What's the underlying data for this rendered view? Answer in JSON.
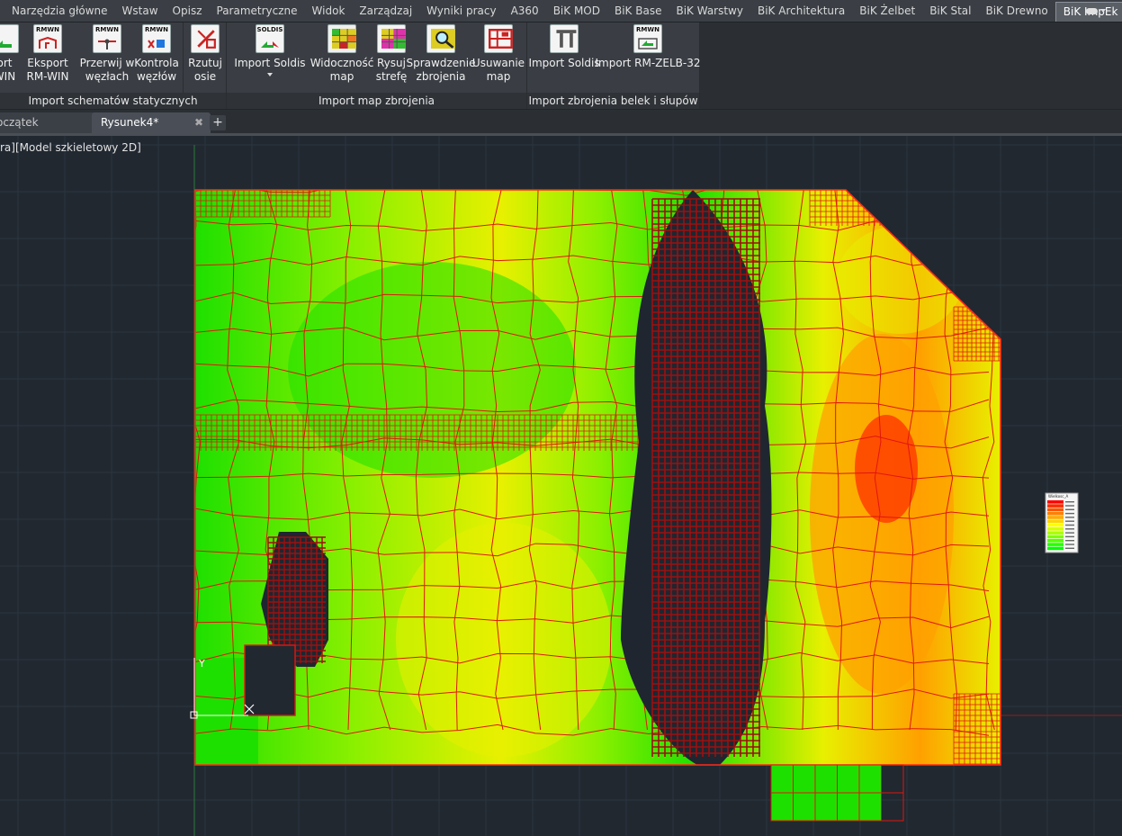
{
  "ribbon": {
    "tabs": [
      {
        "label": "Narzędzia główne",
        "active": false
      },
      {
        "label": "Wstaw",
        "active": false
      },
      {
        "label": "Opisz",
        "active": false
      },
      {
        "label": "Parametryczne",
        "active": false
      },
      {
        "label": "Widok",
        "active": false
      },
      {
        "label": "Zarządzaj",
        "active": false
      },
      {
        "label": "Wyniki pracy",
        "active": false
      },
      {
        "label": "A360",
        "active": false
      },
      {
        "label": "BiK MOD",
        "active": false
      },
      {
        "label": "BiK Base",
        "active": false
      },
      {
        "label": "BiK Warstwy",
        "active": false
      },
      {
        "label": "BiK Architektura",
        "active": false
      },
      {
        "label": "BiK Żelbet",
        "active": false
      },
      {
        "label": "BiK Stal",
        "active": false
      },
      {
        "label": "BiK Drewno",
        "active": false
      },
      {
        "label": "BiK ImpEk",
        "active": true
      }
    ],
    "panels": {
      "static": {
        "title": "Import schematów statycznych",
        "buttons": [
          {
            "line1": "ort",
            "line2": "WIN",
            "icon_text": ""
          },
          {
            "line1": "Eksport",
            "line2": "RM-WIN",
            "icon_text": "RMWN"
          },
          {
            "line1": "Przerwij w",
            "line2": "węzłach",
            "icon_text": "RMWN"
          },
          {
            "line1": "Kontrola",
            "line2": "węzłów",
            "icon_text": "RMWN"
          },
          {
            "line1": "Rzutuj",
            "line2": "osie",
            "icon_text": ""
          }
        ]
      },
      "maps": {
        "title": "Import map zbrojenia",
        "buttons": [
          {
            "line1": "Import Soldis",
            "line2": "",
            "icon_text": "SOLDIS"
          },
          {
            "line1": "Widoczność",
            "line2": "map",
            "icon_text": ""
          },
          {
            "line1": "Rysuj",
            "line2": "strefę",
            "icon_text": ""
          },
          {
            "line1": "Sprawdzenie",
            "line2": "zbrojenia",
            "icon_text": ""
          },
          {
            "line1": "Usuwanie",
            "line2": "map",
            "icon_text": ""
          }
        ]
      },
      "beams": {
        "title": "Import zbrojenia belek i słupów",
        "buttons": [
          {
            "line1": "Import Soldis",
            "line2": "",
            "icon_text": ""
          },
          {
            "line1": "Import RM-ZELB-32",
            "line2": "",
            "icon_text": "RMWN"
          }
        ]
      }
    },
    "colors": {
      "strip": "#3b3f45",
      "panel": "#3a3e44",
      "panel_title": "#2f3338"
    }
  },
  "documents": {
    "tabs": [
      {
        "label": "oczątek",
        "active": false
      },
      {
        "label": "Rysunek4*",
        "active": true
      }
    ],
    "close_glyph": "✖",
    "add_glyph": "+"
  },
  "viewport": {
    "label": "ra][Model szkieletowy 2D]",
    "background": "#212830",
    "ucs": {
      "y_label": "Y"
    },
    "legend": {
      "title": "Wielkosc_A",
      "colors": [
        "#ff0000",
        "#ff2a00",
        "#ff5500",
        "#ff7f00",
        "#ffaa00",
        "#ffd400",
        "#ffff00",
        "#d4ff00",
        "#aaff00",
        "#7fff00",
        "#55ff00",
        "#2aff00",
        "#00ff00"
      ]
    },
    "mesh_line_color": "#e0160f",
    "field_colors": {
      "green": "#1ee000",
      "lime": "#8cf000",
      "yellow": "#e8f000",
      "orange": "#ffa000",
      "red": "#ff3000",
      "dense": "#9b1010"
    }
  }
}
